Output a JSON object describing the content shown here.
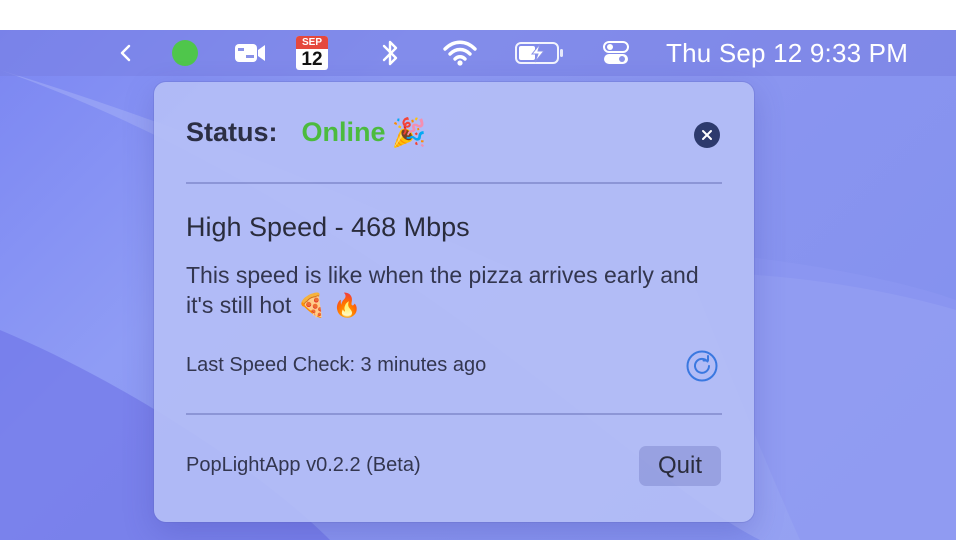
{
  "menubar": {
    "clock": "Thu Sep 12  9:33 PM",
    "calendar": {
      "month": "SEP",
      "day": "12"
    },
    "icons": [
      "chevron-left-icon",
      "status-dot-icon",
      "video-icon",
      "calendar-icon",
      "bluetooth-icon",
      "wifi-icon",
      "battery-charging-icon",
      "control-center-icon"
    ]
  },
  "popover": {
    "status_label": "Status:",
    "status_value": "Online",
    "status_emoji": "🎉",
    "speed_title": "High Speed - 468 Mbps",
    "speed_description": "This speed is like when the pizza arrives early and it's still hot 🍕 🔥",
    "last_check": "Last Speed Check: 3 minutes ago",
    "version": "PopLightApp v0.2.2 (Beta)",
    "quit_label": "Quit"
  },
  "colors": {
    "online_green": "#4cbb3e",
    "status_dot_green": "#4fc64b",
    "refresh_blue": "#3a78e0",
    "close_button": "#2d3a6d"
  }
}
